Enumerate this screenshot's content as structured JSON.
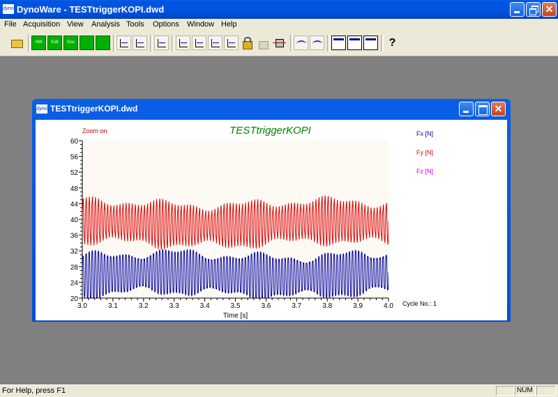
{
  "window": {
    "title": "DynoWare - TESTtriggerKOPI.dwd",
    "icon_text": "dyno"
  },
  "menu": [
    "File",
    "Acquisition",
    "View",
    "Analysis",
    "Tools",
    "Options",
    "Window",
    "Help"
  ],
  "toolbar": {
    "buttons": [
      {
        "name": "open-icon"
      },
      {
        "name": "hardware-icon",
        "label": "HW"
      },
      {
        "name": "edit-icon",
        "label": "Edit"
      },
      {
        "name": "doc-icon",
        "label": "Doc"
      },
      {
        "name": "grid-icon"
      },
      {
        "name": "green-square-icon"
      },
      {
        "name": "chart-icon"
      },
      {
        "name": "chart-icon"
      },
      {
        "name": "calc-icon"
      },
      {
        "name": "chart-icon"
      },
      {
        "name": "chart-icon"
      },
      {
        "name": "chart-icon"
      },
      {
        "name": "chart-icon"
      },
      {
        "name": "lock-icon"
      },
      {
        "name": "unlock-icon"
      },
      {
        "name": "filter-icon"
      },
      {
        "name": "wave-icon"
      },
      {
        "name": "wave-icon"
      },
      {
        "name": "layout-icon"
      },
      {
        "name": "layout-icon"
      },
      {
        "name": "layout-icon"
      },
      {
        "name": "help-icon"
      }
    ]
  },
  "document": {
    "title": "TESTtriggerKOPI.dwd",
    "icon_text": "dyno"
  },
  "chart_data": {
    "type": "line",
    "title": "TESTtriggerKOPI",
    "xlabel": "Time [s]",
    "ylabel": "",
    "xlim": [
      3.0,
      4.0
    ],
    "ylim": [
      20,
      60
    ],
    "x_ticks": [
      "3.0",
      "3.1",
      "3.2",
      "3.3",
      "3.4",
      "3.5",
      "3.6",
      "3.7",
      "3.8",
      "3.9",
      "4.0"
    ],
    "y_ticks": [
      "20",
      "24",
      "28",
      "32",
      "36",
      "40",
      "44",
      "48",
      "52",
      "56",
      "60"
    ],
    "annotation": "Zoom on",
    "cycle_label": "Cycle No.: 1",
    "legend": [
      "Fx [N]",
      "Fy [N]",
      "Fz [N]"
    ],
    "colors": {
      "Fx": "#0000a0",
      "Fy": "#dd0000",
      "Fz": "#cc00cc",
      "title": "#008000",
      "annotation": "#cc0000"
    },
    "series": [
      {
        "name": "Fx [N]",
        "x_range": [
          3.0,
          4.0
        ],
        "cycles": 100,
        "center": 26,
        "amplitude": 5.5,
        "min": 20,
        "max": 33
      },
      {
        "name": "Fy [N]",
        "x_range": [
          3.0,
          4.0
        ],
        "cycles": 100,
        "center": 39,
        "amplitude": 5.0,
        "min": 32,
        "max": 47
      }
    ]
  },
  "status": {
    "help": "For Help, press F1",
    "num": "NUM"
  }
}
